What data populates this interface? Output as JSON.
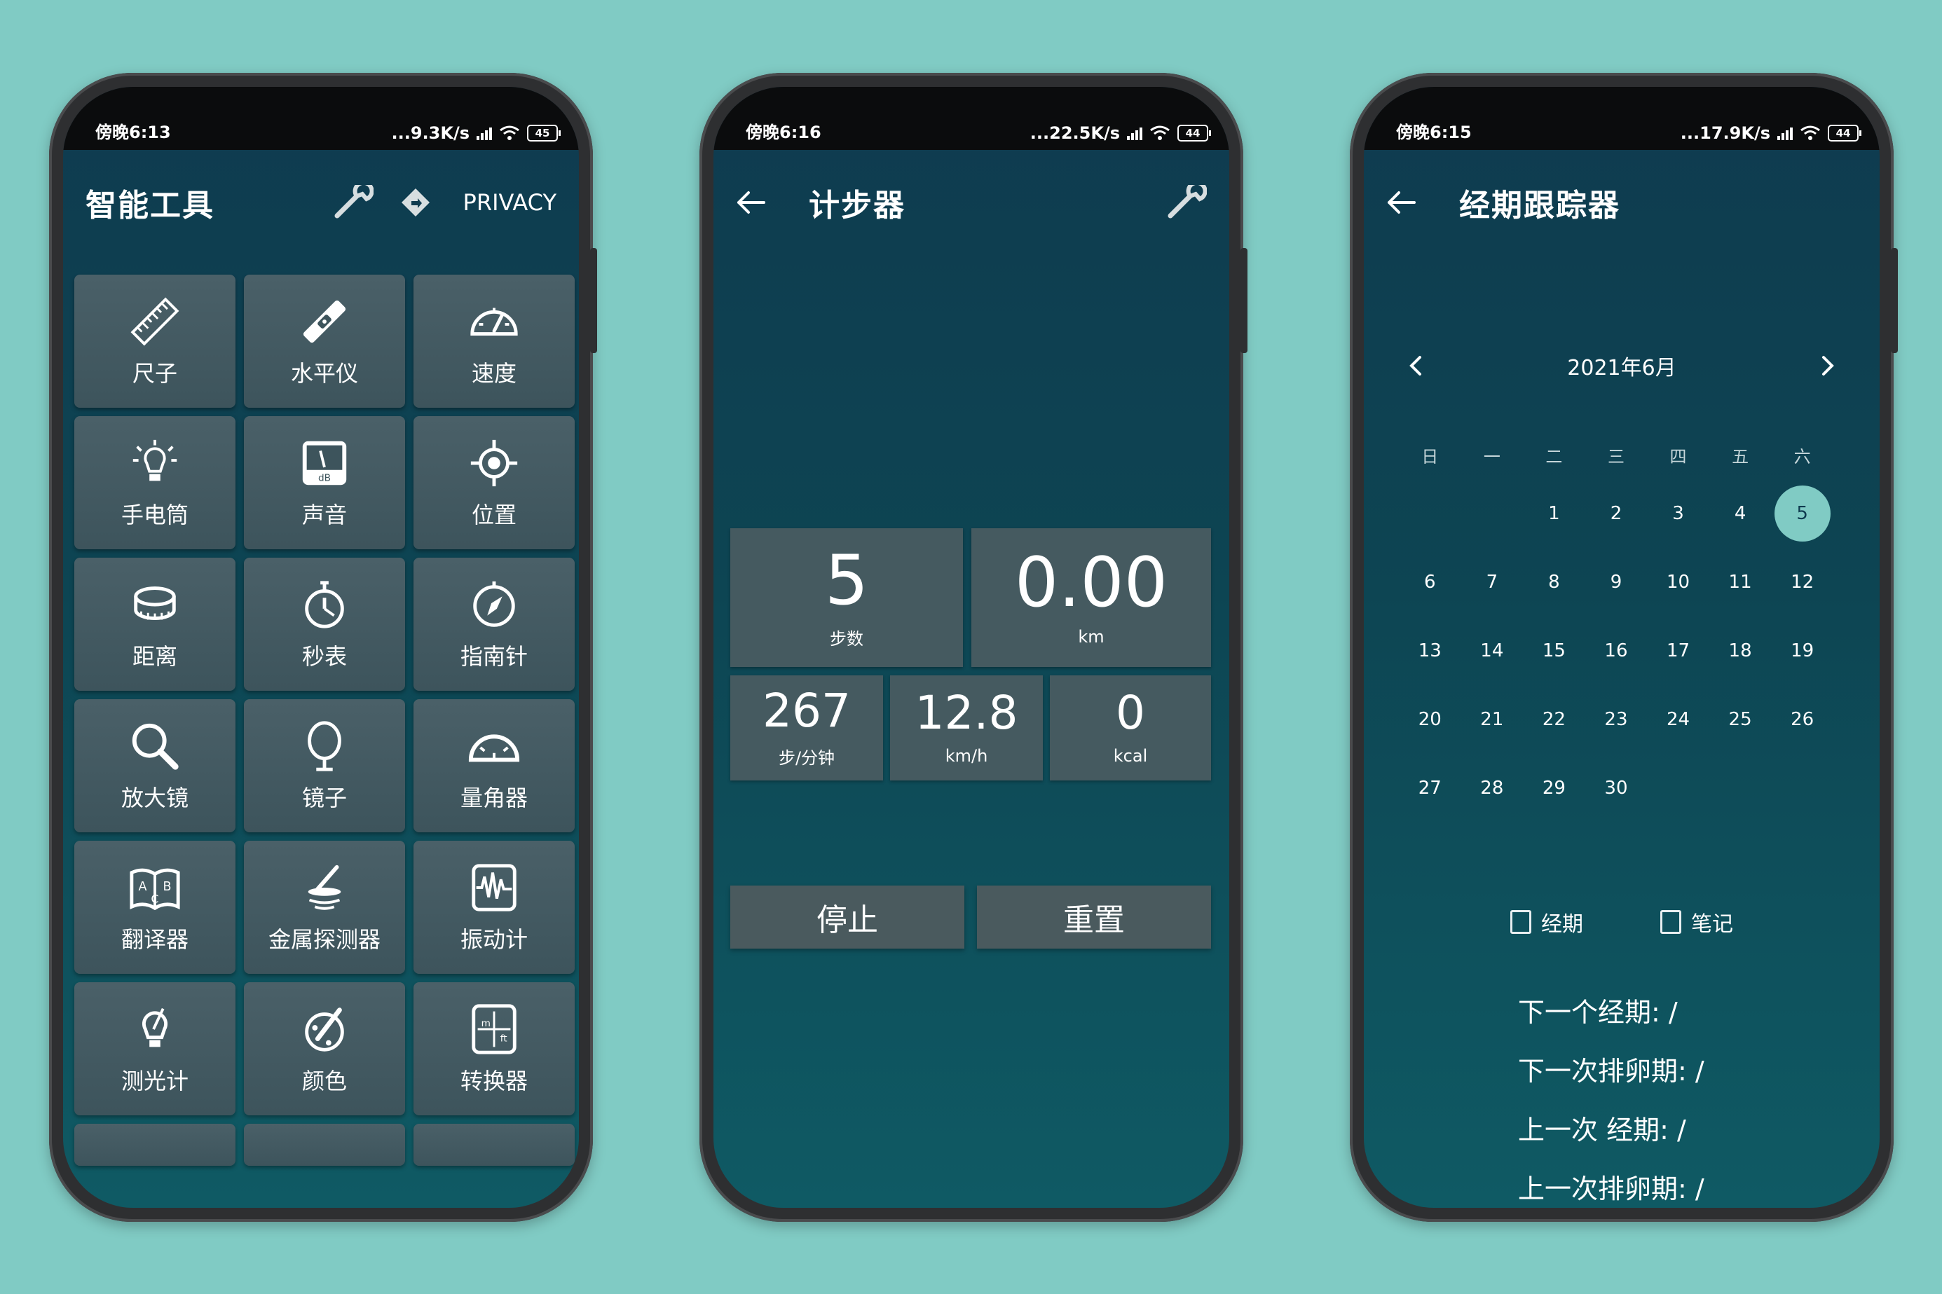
{
  "phone1": {
    "status": {
      "time": "傍晚6:13",
      "net": "...9.3K/s",
      "battery": "45"
    },
    "title": "智能工具",
    "privacy": "PRIVACY",
    "tools": [
      {
        "label": "尺子",
        "icon": "ruler-icon"
      },
      {
        "label": "水平仪",
        "icon": "level-icon"
      },
      {
        "label": "速度",
        "icon": "speedometer-icon"
      },
      {
        "label": "手电筒",
        "icon": "flashlight-icon"
      },
      {
        "label": "声音",
        "icon": "sound-meter-icon"
      },
      {
        "label": "位置",
        "icon": "location-icon"
      },
      {
        "label": "距离",
        "icon": "tape-measure-icon"
      },
      {
        "label": "秒表",
        "icon": "stopwatch-icon"
      },
      {
        "label": "指南针",
        "icon": "compass-icon"
      },
      {
        "label": "放大镜",
        "icon": "magnifier-icon"
      },
      {
        "label": "镜子",
        "icon": "mirror-icon"
      },
      {
        "label": "量角器",
        "icon": "protractor-icon"
      },
      {
        "label": "翻译器",
        "icon": "translator-icon"
      },
      {
        "label": "金属探测器",
        "icon": "metal-detector-icon"
      },
      {
        "label": "振动计",
        "icon": "vibration-meter-icon"
      },
      {
        "label": "测光计",
        "icon": "light-meter-icon"
      },
      {
        "label": "颜色",
        "icon": "color-icon"
      },
      {
        "label": "转换器",
        "icon": "converter-icon"
      }
    ]
  },
  "phone2": {
    "status": {
      "time": "傍晚6:16",
      "net": "...22.5K/s",
      "battery": "44"
    },
    "title": "计步器",
    "steps": {
      "value": "5",
      "label": "步数"
    },
    "distance": {
      "value": "0.00",
      "label": "km"
    },
    "cadence": {
      "value": "267",
      "label": "步/分钟"
    },
    "speed": {
      "value": "12.8",
      "label": "km/h"
    },
    "calories": {
      "value": "0",
      "label": "kcal"
    },
    "stop_label": "停止",
    "reset_label": "重置"
  },
  "phone3": {
    "status": {
      "time": "傍晚6:15",
      "net": "...17.9K/s",
      "battery": "44"
    },
    "title": "经期跟踪器",
    "month": "2021年6月",
    "weekdays": [
      "日",
      "一",
      "二",
      "三",
      "四",
      "五",
      "六"
    ],
    "first_weekday": 2,
    "days_in_month": 30,
    "selected_day": 5,
    "check_period": "经期",
    "check_note": "笔记",
    "next_period": "下一个经期: /",
    "next_ovulation": "下一次排卵期: /",
    "last_period": "上一次 经期: /",
    "last_ovulation": "上一次排卵期: /"
  },
  "colors": {
    "background": "#80cbc4",
    "screen": "#0f3b4f",
    "tile": "#455a60",
    "selected": "#80cbc4"
  }
}
